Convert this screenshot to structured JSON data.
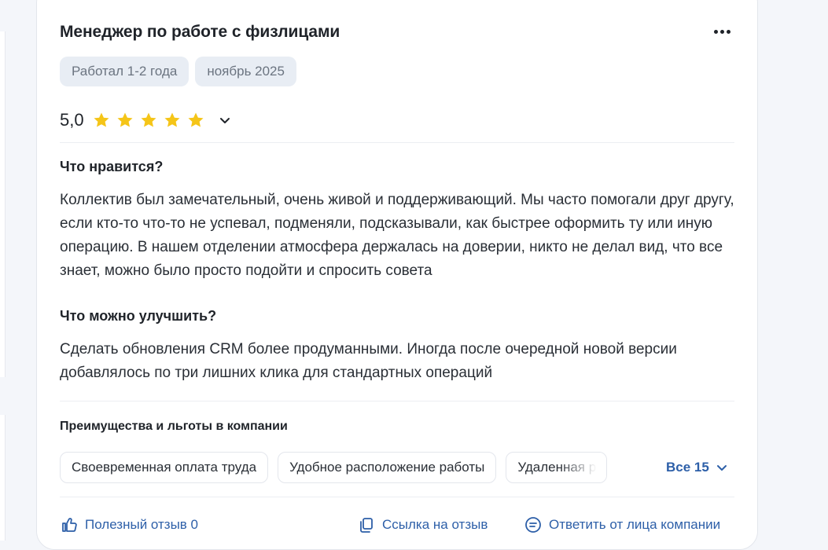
{
  "review": {
    "title": "Менеджер по работе с физлицами",
    "tags": [
      "Работал 1-2 года",
      "ноябрь 2025"
    ],
    "rating": {
      "value": "5,0",
      "stars": 5,
      "max_stars": 5,
      "star_color": "#f5c518"
    },
    "likes": {
      "heading": "Что нравится?",
      "text": "Коллектив был замечательный, очень живой и поддерживающий. Мы часто помогали друг другу, если кто-то что-то не успевал, подменяли, подсказывали, как быстрее оформить ту или иную операцию. В нашем отделении атмосфера держалась на доверии, никто не делал вид, что все знает, можно было просто подойти и спросить совета"
    },
    "improve": {
      "heading": "Что можно улучшить?",
      "text": "Сделать обновления CRM более продуманными. Иногда после очередной новой версии добавлялось по три лишних клика для стандартных операций"
    },
    "benefits": {
      "heading": "Преимущества и льготы в компании",
      "items": [
        "Своевременная оплата труда",
        "Удобное расположение работы",
        "Удаленная работа"
      ],
      "show_all": "Все 15"
    },
    "footer": {
      "helpful": "Полезный отзыв 0",
      "link": "Ссылка на отзыв",
      "reply": "Ответить от лица компании"
    }
  },
  "colors": {
    "accent": "#2d5fa8",
    "chip_bg": "#e8edf4",
    "page_bg": "#f4f6fa"
  }
}
